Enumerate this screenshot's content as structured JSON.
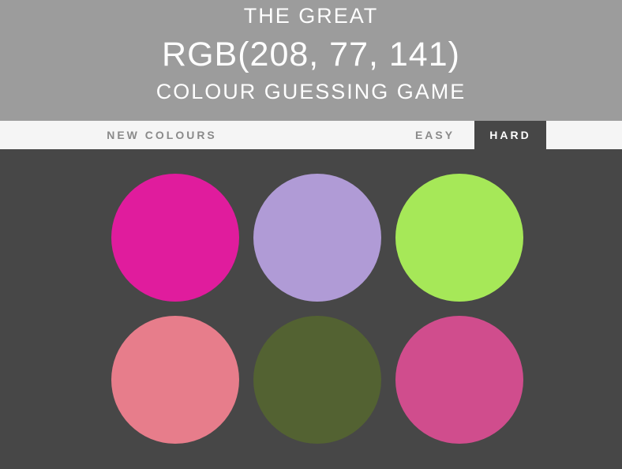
{
  "header": {
    "line1": "THE GREAT",
    "rgb_display": "RGB(208, 77, 141)",
    "line3": "COLOUR GUESSING GAME",
    "background_color": "#9c9c9c"
  },
  "controls": {
    "new_colours_label": "NEW COLOURS",
    "easy_label": "EASY",
    "hard_label": "HARD",
    "selected_mode": "HARD"
  },
  "board": {
    "background_color": "#474747",
    "squares": [
      {
        "color": "#e01c9d"
      },
      {
        "color": "#b09bd6"
      },
      {
        "color": "#a6e858"
      },
      {
        "color": "#e77d8b"
      },
      {
        "color": "#536232"
      },
      {
        "color": "#d04d8d"
      }
    ]
  }
}
